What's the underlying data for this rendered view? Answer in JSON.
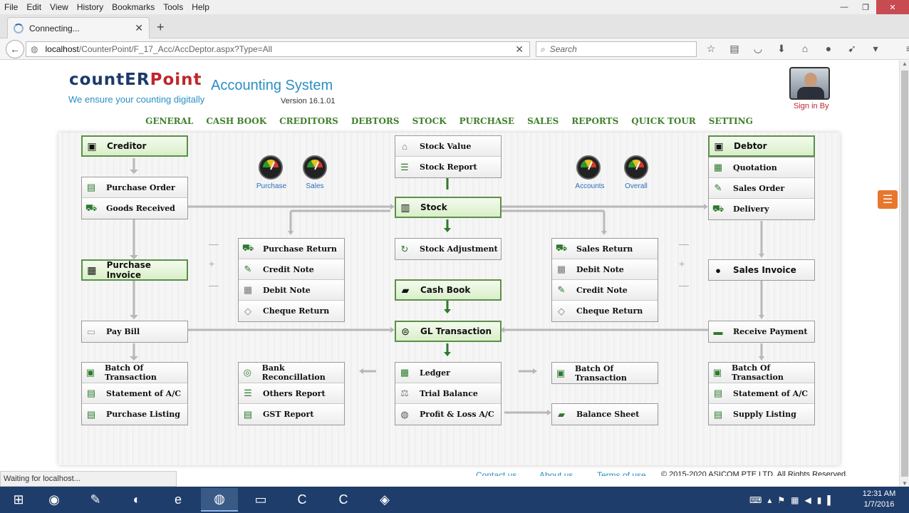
{
  "menu": [
    "File",
    "Edit",
    "View",
    "History",
    "Bookmarks",
    "Tools",
    "Help"
  ],
  "window_controls": {
    "minimize": "—",
    "restore": "❐",
    "close": "✕"
  },
  "tab": {
    "title": "Connecting...",
    "close": "✕",
    "new": "+"
  },
  "address": {
    "host": "localhost",
    "path": "/CounterPoint/F_17_Acc/AccDeptor.aspx?Type=All"
  },
  "search": {
    "placeholder": "Search"
  },
  "header": {
    "logo_a": "countER",
    "logo_b": "Point",
    "tagline": "We ensure your counting digitally",
    "app_title": "Accounting System",
    "version": "Version 16.1.01",
    "sign_in": "Sign in By"
  },
  "nav": [
    "GENERAL",
    "CASH BOOK",
    "CREDITORS",
    "DEBTORS",
    "STOCK",
    "PURCHASE",
    "SALES",
    "REPORTS",
    "QUICK TOUR",
    "SETTING"
  ],
  "gauges": [
    "Purchase",
    "Sales",
    "Accounts",
    "Overall"
  ],
  "creditor": {
    "title": "Creditor",
    "items": [
      "Purchase Order",
      "Goods Received"
    ]
  },
  "purchase_invoice": "Purchase Invoice",
  "pay_bill": "Pay Bill",
  "creditor_reports": [
    "Batch Of Transaction",
    "Statement of A/C",
    "Purchase Listing"
  ],
  "purchase_returns": [
    "Purchase Return",
    "Credit Note",
    "Debit Note",
    "Cheque Return"
  ],
  "stock_reports": [
    "Stock Value",
    "Stock Report"
  ],
  "stock": "Stock",
  "stock_adjustment": "Stock Adjustment",
  "cash_book": "Cash Book",
  "gl_transaction": "GL Transaction",
  "gl_reports": [
    "Ledger",
    "Trial Balance",
    "Profit & Loss A/C"
  ],
  "bank_reports": [
    "Bank Reconcillation",
    "Others Report",
    "GST Report"
  ],
  "sales_returns": [
    "Sales Return",
    "Debit Note",
    "Credit Note",
    "Cheque Return"
  ],
  "batch_mid": "Batch Of Transaction",
  "balance_sheet": "Balance Sheet",
  "debtor": {
    "title": "Debtor",
    "items": [
      "Quotation",
      "Sales Order",
      "Delivery"
    ]
  },
  "sales_invoice": "Sales Invoice",
  "receive_payment": "Receive Payment",
  "debtor_reports": [
    "Batch Of Transaction",
    "Statement of A/C",
    "Supply Listing"
  ],
  "footer": {
    "contact": "Contact us",
    "about": "About us",
    "terms": "Terms of use",
    "copyright": "© 2015-2020 ASICOM PTE LTD, All Rights Reserved."
  },
  "status": "Waiting for localhost...",
  "clock": {
    "time": "12:31 AM",
    "date": "1/7/2016"
  },
  "colors": {
    "accent_green": "#3f7f2c",
    "link_blue": "#2a8fc4",
    "brand_red": "#c0262d"
  }
}
